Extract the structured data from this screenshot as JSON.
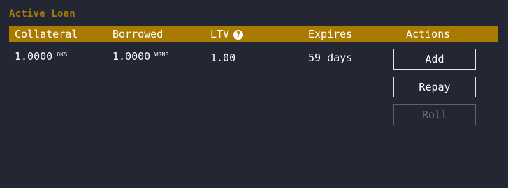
{
  "loan": {
    "title": "Active Loan",
    "headers": {
      "collateral": "Collateral",
      "borrowed": "Borrowed",
      "ltv": "LTV",
      "expires": "Expires",
      "actions": "Actions"
    },
    "row": {
      "collateral_amount": "1.0000",
      "collateral_token": "OKS",
      "borrowed_amount": "1.0000",
      "borrowed_token": "WBNB",
      "ltv": "1.00",
      "expires": "59 days"
    },
    "buttons": {
      "add": "Add",
      "repay": "Repay",
      "roll": "Roll"
    }
  },
  "icons": {
    "ltv_help": "?"
  },
  "colors": {
    "background": "#222733",
    "accent": "#a87b00",
    "text": "#ffffff",
    "disabled": "#6f747e"
  }
}
